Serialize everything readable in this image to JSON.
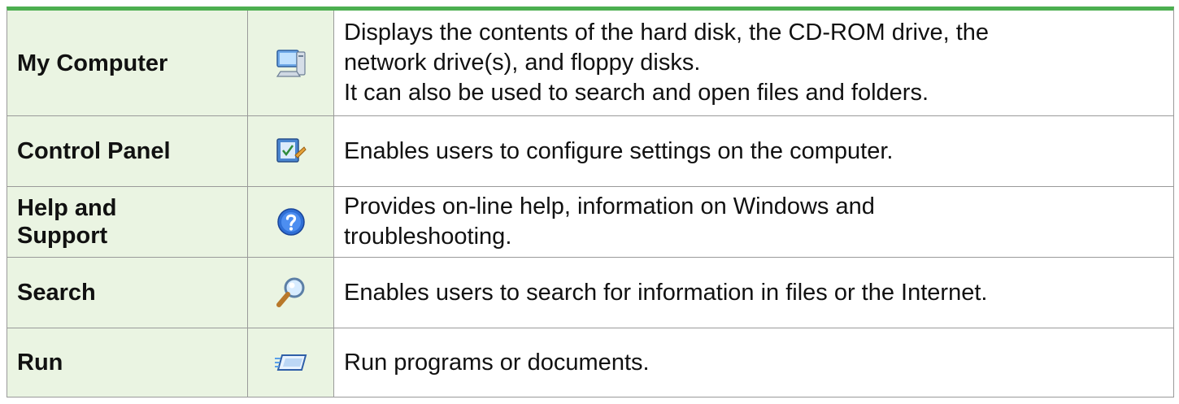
{
  "rows": [
    {
      "name": "My Computer",
      "icon": "my-computer-icon",
      "description": [
        "Displays the contents of the hard disk, the CD-ROM drive, the",
        "network drive(s), and floppy disks.",
        "It can also be used to search and open files and folders."
      ]
    },
    {
      "name": "Control Panel",
      "icon": "control-panel-icon",
      "description": [
        "Enables users to configure settings on the computer."
      ]
    },
    {
      "name": "Help and Support",
      "name_lines": [
        "Help and",
        "Support"
      ],
      "icon": "help-and-support-icon",
      "description": [
        "Provides on-line help, information on Windows and",
        "troubleshooting."
      ]
    },
    {
      "name": "Search",
      "icon": "search-icon",
      "description": [
        "Enables users to search for information in files or the Internet."
      ]
    },
    {
      "name": "Run",
      "icon": "run-icon",
      "description": [
        "Run programs or documents."
      ]
    }
  ],
  "colors": {
    "header_rule": "#4caf50",
    "label_cell_background": "#eaf4e2",
    "border": "#9a9a9a"
  }
}
